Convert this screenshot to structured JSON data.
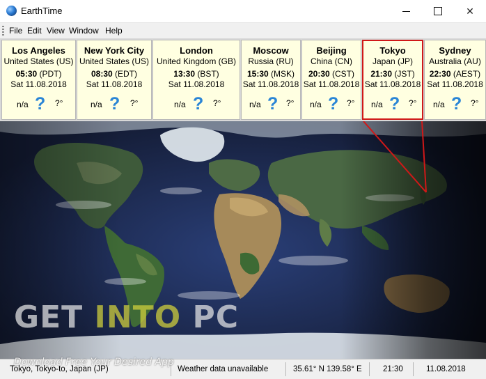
{
  "window": {
    "title": "EarthTime",
    "minimize_glyph": "",
    "maximize_glyph": "",
    "close_glyph": "✕"
  },
  "menu": [
    "File",
    "Edit",
    "View",
    "Window",
    "Help"
  ],
  "cities": [
    {
      "name": "Los Angeles",
      "country": "United States (US)",
      "time": "05:30",
      "tz": "(PDT)",
      "date": "Sat 11.08.2018",
      "weather": "n/a",
      "weather_icon": "question-mark-icon",
      "temp": "?°"
    },
    {
      "name": "New York City",
      "country": "United States (US)",
      "time": "08:30",
      "tz": "(EDT)",
      "date": "Sat 11.08.2018",
      "weather": "n/a",
      "weather_icon": "question-mark-icon",
      "temp": "?°"
    },
    {
      "name": "London",
      "country": "United Kingdom (GB)",
      "time": "13:30",
      "tz": "(BST)",
      "date": "Sat 11.08.2018",
      "weather": "n/a",
      "weather_icon": "question-mark-icon",
      "temp": "?°"
    },
    {
      "name": "Moscow",
      "country": "Russia (RU)",
      "time": "15:30",
      "tz": "(MSK)",
      "date": "Sat 11.08.2018",
      "weather": "n/a",
      "weather_icon": "question-mark-icon",
      "temp": "?°"
    },
    {
      "name": "Beijing",
      "country": "China (CN)",
      "time": "20:30",
      "tz": "(CST)",
      "date": "Sat 11.08.2018",
      "weather": "n/a",
      "weather_icon": "question-mark-icon",
      "temp": "?°"
    },
    {
      "name": "Tokyo",
      "country": "Japan (JP)",
      "time": "21:30",
      "tz": "(JST)",
      "date": "Sat 11.08.2018",
      "weather": "n/a",
      "weather_icon": "question-mark-icon",
      "temp": "?°"
    },
    {
      "name": "Sydney",
      "country": "Australia (AU)",
      "time": "22:30",
      "tz": "(AEST)",
      "date": "Sat 11.08.2018",
      "weather": "n/a",
      "weather_icon": "question-mark-icon",
      "temp": "?°"
    }
  ],
  "status": {
    "location": "Tokyo, Tokyo-to, Japan (JP)",
    "weather": "Weather data unavailable",
    "coords": "35.61° N  139.58° E",
    "time": "21:30",
    "date": "11.08.2018"
  },
  "watermark": {
    "get": "GET ",
    "into": "INTO ",
    "pc": "PC",
    "subtitle": "Download Free Your Desired App"
  },
  "colors": {
    "card_bg": "#ffffe1",
    "highlight": "#d01818",
    "weather_icon": "#2a85d6"
  }
}
